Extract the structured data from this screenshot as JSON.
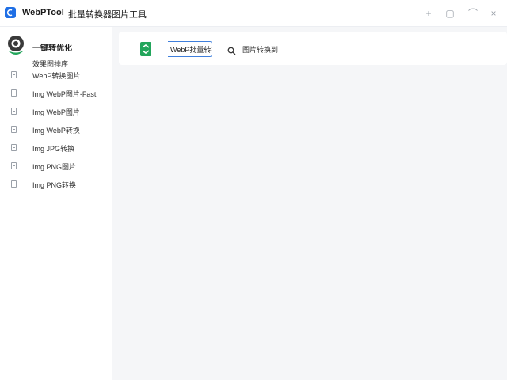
{
  "app": {
    "name": "WebPTool",
    "subtitle": "批量转换器图片工具"
  },
  "window_controls": {
    "add": "+",
    "restore": "▢",
    "minimize": "⌒",
    "close": "×"
  },
  "sidebar": {
    "title": "一键转优化",
    "subtitle": "效果图排序",
    "items": [
      {
        "label": "WebP转换图片"
      },
      {
        "label": "Img  WebP图片-Fast"
      },
      {
        "label": "Img  WebP图片"
      },
      {
        "label": "Img  WebP转换"
      },
      {
        "label": "Img  JPG转换"
      },
      {
        "label": "Img  PNG图片"
      },
      {
        "label": "Img  PNG转换"
      }
    ]
  },
  "toolbar": {
    "action_label": "WebP批量转换",
    "search_label": "图片转换到"
  },
  "colors": {
    "accent": "#1f6fe5",
    "green": "#22a55b",
    "main_bg": "#f5f6f8"
  }
}
